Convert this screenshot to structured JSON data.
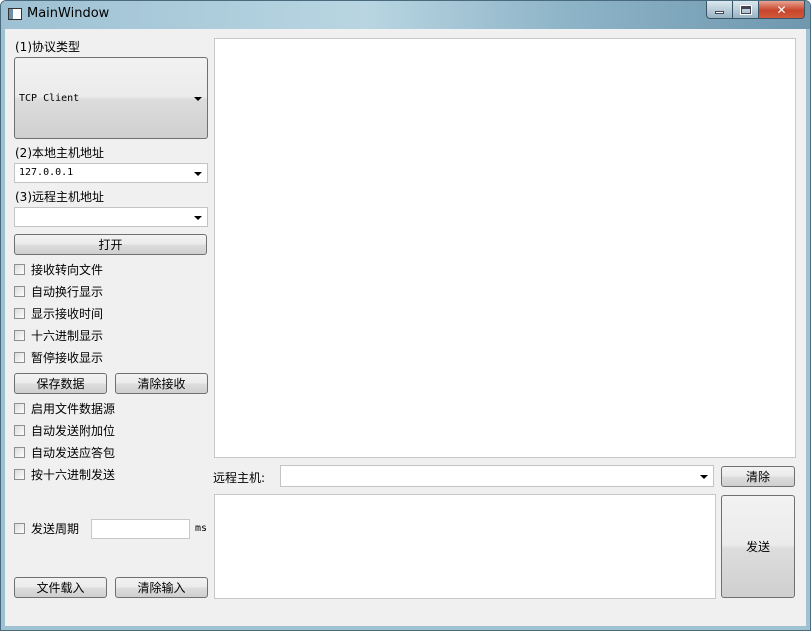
{
  "window": {
    "title": "MainWindow",
    "controls": {
      "minimize": "minimize",
      "maximize": "maximize",
      "close": "✕"
    }
  },
  "left": {
    "protocol_label": "(1)协议类型",
    "protocol_value": "TCP Client",
    "local_host_label": "(2)本地主机地址",
    "local_host_value": "127.0.0.1",
    "remote_host_label": "(3)远程主机地址",
    "remote_host_value": "",
    "open_button": "打开",
    "receive_options": [
      {
        "label": "接收转向文件",
        "checked": false
      },
      {
        "label": "自动换行显示",
        "checked": false
      },
      {
        "label": "显示接收时间",
        "checked": false
      },
      {
        "label": "十六进制显示",
        "checked": false
      },
      {
        "label": "暂停接收显示",
        "checked": false
      }
    ],
    "save_data_button": "保存数据",
    "clear_receive_button": "清除接收",
    "send_options": [
      {
        "label": "启用文件数据源",
        "checked": false
      },
      {
        "label": "自动发送附加位",
        "checked": false
      },
      {
        "label": "自动发送应答包",
        "checked": false
      },
      {
        "label": "按十六进制发送",
        "checked": false
      }
    ],
    "send_period_label": "发送周期",
    "send_period_value": "",
    "send_period_unit": "ms",
    "load_file_button": "文件载入",
    "clear_input_button": "清除输入"
  },
  "right": {
    "receive_text": "",
    "remote_host_label": "远程主机:",
    "remote_host_value": "",
    "clear_button": "清除",
    "send_text": "",
    "send_button": "发送"
  }
}
